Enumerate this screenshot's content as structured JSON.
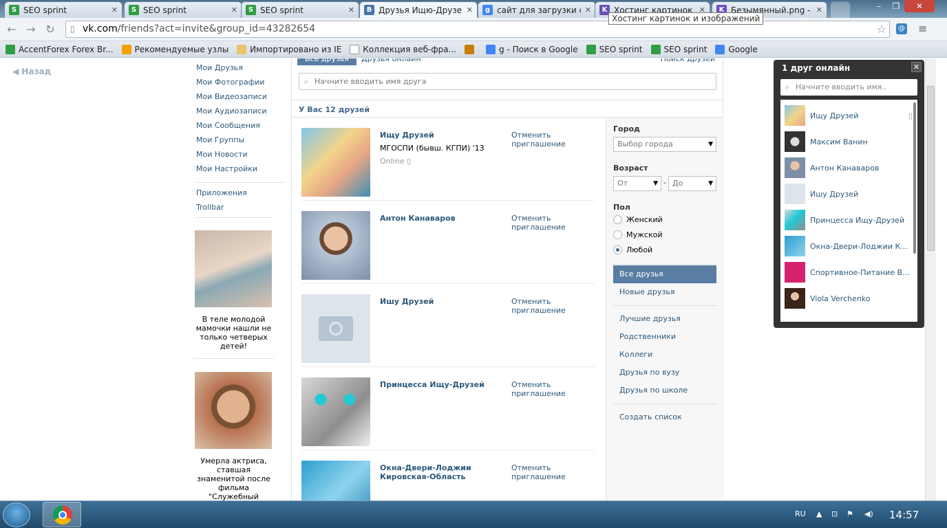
{
  "browser": {
    "tabs": [
      {
        "title": "SEO sprint",
        "icon": "seo-sprint-icon",
        "color": "#2f9e44"
      },
      {
        "title": "SEO sprint",
        "icon": "seo-sprint-icon",
        "color": "#2f9e44"
      },
      {
        "title": "SEO sprint",
        "icon": "seo-sprint-icon",
        "color": "#2f9e44"
      },
      {
        "title": "Друзья Ищю-Друзея ∠",
        "icon": "vk-icon",
        "color": "#4a76a8"
      },
      {
        "title": "сайт для загрузки скр",
        "icon": "google-icon",
        "color": "#4285f4"
      },
      {
        "title": "Хостинг картинок и и",
        "icon": "hosting-icon",
        "color": "#6b4fbb"
      },
      {
        "title": "Безымянный.png - Пр",
        "icon": "hosting-icon",
        "color": "#6b4fbb"
      }
    ],
    "tooltip": "Хостинг картинок и изображений",
    "url_domain": "vk.com",
    "url_path": "/friends?act=invite&group_id=43282654",
    "bookmarks": [
      {
        "label": "AccentForex Forex Br...",
        "color": "#2f9e44"
      },
      {
        "label": "Рекомендуемые узлы",
        "color": "#f59f00"
      },
      {
        "label": "Импортировано из IE",
        "color": "#e9c46a"
      },
      {
        "label": "Коллекция веб-фра...",
        "color": "#ffffff"
      },
      {
        "label": "",
        "color": "#c87f0a"
      },
      {
        "label": "g - Поиск в Google",
        "color": "#4285f4"
      },
      {
        "label": "SEO sprint",
        "color": "#2f9e44"
      },
      {
        "label": "SEO sprint",
        "color": "#2f9e44"
      },
      {
        "label": "Google",
        "color": "#4285f4"
      }
    ]
  },
  "page": {
    "back_label": "Назад",
    "left_menu": [
      "Мои Друзья",
      "Мои Фотографии",
      "Мои Видеозаписи",
      "Мои Аудиозаписи",
      "Мои Сообщения",
      "Мои Группы",
      "Мои Новости",
      "Мои Настройки"
    ],
    "left_menu2": [
      "Приложения",
      "Trollbar"
    ],
    "ads": [
      {
        "text": "В теле молодой мамочки нашли не только четверых детей!"
      },
      {
        "text": "Умерла актриса, ставшая знаменитой после фильма \"Служебный роман\""
      }
    ],
    "tabs": [
      "Все друзья",
      "Друзья онлайн",
      "Поиск друзей"
    ],
    "search_placeholder": "Начните вводить имя друга",
    "count_label": "У Вас 12 друзей",
    "friends": [
      {
        "name": "Ищу Друзей",
        "sub": "МГОСПИ (бывш. КГПИ) '13",
        "online": "Online",
        "action": "Отменить приглашение"
      },
      {
        "name": "Антон Канаваров",
        "sub": "",
        "online": "",
        "action": "Отменить приглашение"
      },
      {
        "name": "Ишу Друзей",
        "sub": "",
        "online": "",
        "action": "Отменить приглашение"
      },
      {
        "name": "Принцесса Ищу-Друзей",
        "sub": "",
        "online": "",
        "action": "Отменить приглашение"
      },
      {
        "name": "Окна-Двери-Лоджии Кировская-Область",
        "sub": "",
        "online": "",
        "action": "Отменить приглашение"
      }
    ],
    "filters": {
      "city_label": "Город",
      "city_value": "Выбор города",
      "age_label": "Возраст",
      "age_from": "От",
      "age_dash": "-",
      "age_to": "До",
      "sex_label": "Пол",
      "sex_options": [
        "Женский",
        "Мужской",
        "Любой"
      ],
      "sex_selected": "Любой",
      "lists": [
        "Все друзья",
        "Новые друзья"
      ],
      "lists2": [
        "Лучшие друзья",
        "Родственники",
        "Коллеги",
        "Друзья по вузу",
        "Друзья по школе"
      ],
      "create_list": "Создать список"
    }
  },
  "online_popup": {
    "title": "1 друг онлайн",
    "search_placeholder": "Начните вводить имя..",
    "friends": [
      "Ищу Друзей",
      "Максим Ванин",
      "Антон Канаваров",
      "Ишу Друзей",
      "Принцесса Ищу-Друзей",
      "Окна-Двери-Лоджии К...",
      "Спортивное-Питание В...",
      "Viola Verchenko"
    ]
  },
  "taskbar": {
    "lang": "RU",
    "clock": "14:57"
  }
}
